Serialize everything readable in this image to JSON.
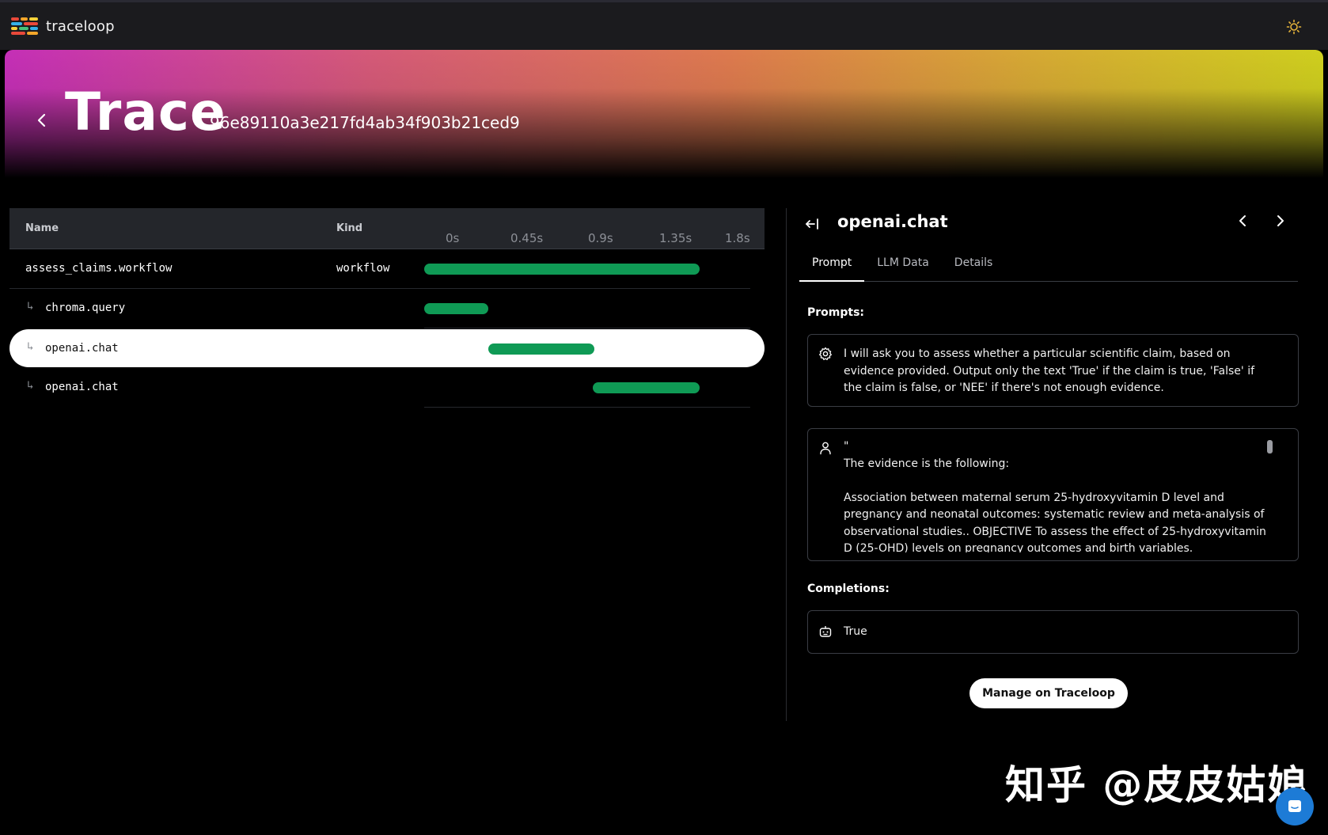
{
  "app": {
    "brand": "traceloop"
  },
  "hero": {
    "title": "Trace",
    "trace_id": "96e89110a3e217fd4ab34f903b21ced9"
  },
  "table": {
    "columns": {
      "name": "Name",
      "kind": "Kind"
    },
    "ticks": [
      "0s",
      "0.45s",
      "0.9s",
      "1.35s",
      "1.8s"
    ],
    "rows": [
      {
        "name": "assess_claims.workflow",
        "kind": "workflow",
        "start_s": 0.0,
        "end_s": 1.8,
        "depth": 0
      },
      {
        "name": "chroma.query",
        "kind": "",
        "start_s": 0.0,
        "end_s": 0.42,
        "depth": 1
      },
      {
        "name": "openai.chat",
        "kind": "",
        "start_s": 0.42,
        "end_s": 1.11,
        "depth": 1,
        "selected": true
      },
      {
        "name": "openai.chat",
        "kind": "",
        "start_s": 1.1,
        "end_s": 1.8,
        "depth": 1
      }
    ],
    "bar_color": "#0f9a55"
  },
  "panel": {
    "title": "openai.chat",
    "tabs": [
      "Prompt",
      "LLM Data",
      "Details"
    ],
    "active_tab": "Prompt",
    "prompts_label": "Prompts:",
    "prompts": [
      {
        "role_icon": "gear-icon",
        "text": "I will ask you to assess whether a particular scientific claim, based on evidence provided. Output only the text 'True' if the claim is true, 'False' if the claim is false, or 'NEE' if there's not enough evidence."
      },
      {
        "role_icon": "user-icon",
        "text": "\"\nThe evidence is the following:\n\nAssociation between maternal serum 25-hydroxyvitamin D level and pregnancy and neonatal outcomes: systematic review and meta-analysis of observational studies.. OBJECTIVE To assess the effect of 25-hydroxyvitamin D (25-OHD) levels on pregnancy outcomes and birth variables."
      }
    ],
    "completions_label": "Completions:",
    "completion": {
      "role_icon": "robot-icon",
      "text": "True"
    },
    "cta_label": "Manage on Traceloop"
  },
  "watermark": "知乎 @皮皮姑娘"
}
